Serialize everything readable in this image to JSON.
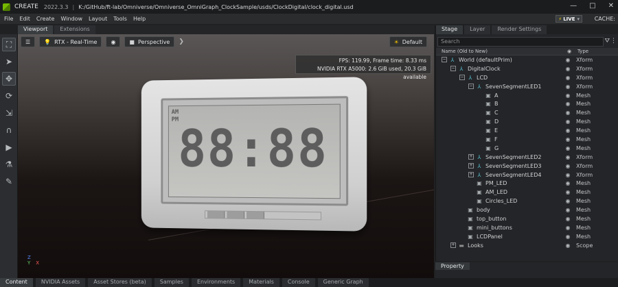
{
  "titlebar": {
    "app": "CREATE",
    "version": "2022.3.3",
    "separator": "|",
    "path": "K:/GitHub/ft-lab/Omniverse/Omniverse_OmniGraph_ClockSample/usds/ClockDigital/clock_digital.usd",
    "minimize": "—",
    "maximize": "□",
    "close": "✕"
  },
  "menu": [
    "File",
    "Edit",
    "Create",
    "Window",
    "Layout",
    "Tools",
    "Help"
  ],
  "live": {
    "label": "LIVE",
    "dropdown": "▾"
  },
  "cache": "CACHE:",
  "viewport_tabs": [
    "Viewport",
    "Extensions"
  ],
  "viewport": {
    "render_mode": "RTX - Real-Time",
    "camera": "Perspective",
    "lighting": "Default",
    "fps": "FPS: 119.99, Frame time: 8.33 ms",
    "gpu": "NVIDIA RTX A5000: 2.6 GiB used, 20.3 GiB available",
    "axis_z": "Z",
    "axis_x": "X",
    "axis_y": "Y"
  },
  "clock": {
    "am": "AM",
    "pm": "PM",
    "digits": "88:88"
  },
  "stage": {
    "tabs": [
      "Stage",
      "Layer",
      "Render Settings"
    ],
    "search_placeholder": "Search",
    "col_name": "Name (Old to New)",
    "col_type": "Type",
    "rows": [
      {
        "label": "World (defaultPrim)",
        "type": "Xform",
        "depth": 0,
        "exp": "−",
        "icon": "xform"
      },
      {
        "label": "DigitalClock",
        "type": "Xform",
        "depth": 1,
        "exp": "−",
        "icon": "xform"
      },
      {
        "label": "LCD",
        "type": "Xform",
        "depth": 2,
        "exp": "−",
        "icon": "xform"
      },
      {
        "label": "SevenSegmentLED1",
        "type": "Xform",
        "depth": 3,
        "exp": "−",
        "icon": "xform"
      },
      {
        "label": "A",
        "type": "Mesh",
        "depth": 4,
        "exp": "",
        "icon": "mesh"
      },
      {
        "label": "B",
        "type": "Mesh",
        "depth": 4,
        "exp": "",
        "icon": "mesh"
      },
      {
        "label": "C",
        "type": "Mesh",
        "depth": 4,
        "exp": "",
        "icon": "mesh"
      },
      {
        "label": "D",
        "type": "Mesh",
        "depth": 4,
        "exp": "",
        "icon": "mesh"
      },
      {
        "label": "E",
        "type": "Mesh",
        "depth": 4,
        "exp": "",
        "icon": "mesh"
      },
      {
        "label": "F",
        "type": "Mesh",
        "depth": 4,
        "exp": "",
        "icon": "mesh"
      },
      {
        "label": "G",
        "type": "Mesh",
        "depth": 4,
        "exp": "",
        "icon": "mesh"
      },
      {
        "label": "SevenSegmentLED2",
        "type": "Xform",
        "depth": 3,
        "exp": "+",
        "icon": "xform"
      },
      {
        "label": "SevenSegmentLED3",
        "type": "Xform",
        "depth": 3,
        "exp": "+",
        "icon": "xform"
      },
      {
        "label": "SevenSegmentLED4",
        "type": "Xform",
        "depth": 3,
        "exp": "+",
        "icon": "xform"
      },
      {
        "label": "PM_LED",
        "type": "Mesh",
        "depth": 3,
        "exp": "",
        "icon": "mesh"
      },
      {
        "label": "AM_LED",
        "type": "Mesh",
        "depth": 3,
        "exp": "",
        "icon": "mesh"
      },
      {
        "label": "Circles_LED",
        "type": "Mesh",
        "depth": 3,
        "exp": "",
        "icon": "mesh"
      },
      {
        "label": "body",
        "type": "Mesh",
        "depth": 2,
        "exp": "",
        "icon": "mesh"
      },
      {
        "label": "top_button",
        "type": "Mesh",
        "depth": 2,
        "exp": "",
        "icon": "mesh"
      },
      {
        "label": "mini_buttons",
        "type": "Mesh",
        "depth": 2,
        "exp": "",
        "icon": "mesh"
      },
      {
        "label": "LCDPanel",
        "type": "Mesh",
        "depth": 2,
        "exp": "",
        "icon": "mesh"
      },
      {
        "label": "Looks",
        "type": "Scope",
        "depth": 1,
        "exp": "+",
        "icon": "scope"
      }
    ]
  },
  "property_tab": "Property",
  "bottom_tabs": [
    "Content",
    "NVIDIA Assets",
    "Asset Stores (beta)",
    "Samples",
    "Environments",
    "Materials",
    "Console",
    "Generic Graph"
  ],
  "colors": {
    "accent_green": "#76b900",
    "xform_icon": "#5cc4d6",
    "live_bolt": "#e8c800"
  }
}
